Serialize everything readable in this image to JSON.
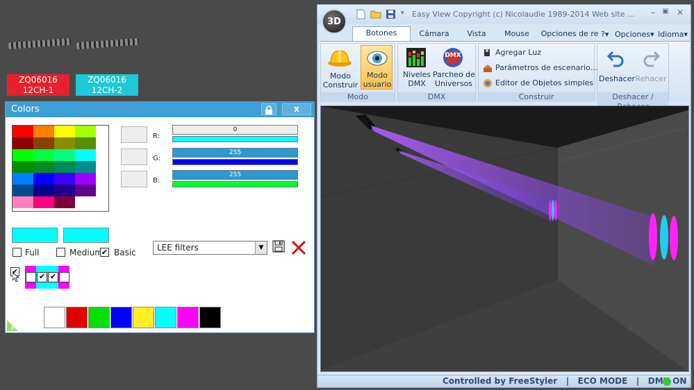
{
  "fixtures": [
    {
      "label_line1": "ZQ06016",
      "label_line2": "12CH-1",
      "color": "#e81f2c"
    },
    {
      "label_line1": "ZQ06016",
      "label_line2": "12CH-2",
      "color": "#1ec8d6"
    }
  ],
  "colors_panel": {
    "title": "Colors",
    "lock_icon": "lock-icon",
    "close_label": "x",
    "palette": [
      [
        "#ff0000",
        "#ff8000",
        "#ffff00",
        "#a6ff00"
      ],
      [
        "#8c0000",
        "#8c4000",
        "#8c8c00",
        "#5a8c00"
      ],
      [
        "#00ff00",
        "#00ff40",
        "#00ff80",
        "#00ffff"
      ],
      [
        "#008c00",
        "#008c20",
        "#008c50",
        "#008c8c"
      ],
      [
        "#0080ff",
        "#0000ff",
        "#4000ff",
        "#a000ff"
      ],
      [
        "#004c8c",
        "#00008c",
        "#20008c",
        "#60008c"
      ],
      [
        "#ff80c0",
        "#ff0080",
        "#80003c",
        "#ffffff"
      ]
    ],
    "preview_color_1": "#00ffff",
    "preview_color_2": "#00ffff",
    "channels": [
      {
        "label": "R:",
        "value": "0",
        "level": 0,
        "bar_color": "#00ffff"
      },
      {
        "label": "G:",
        "value": "255",
        "level": 1,
        "bar_color": "#0000ff"
      },
      {
        "label": "B:",
        "value": "255",
        "level": 1,
        "bar_color": "#00ff33"
      }
    ],
    "options": [
      {
        "label": "Full",
        "checked": false
      },
      {
        "label": "Medium",
        "checked": false
      },
      {
        "label": "Basic",
        "checked": true
      }
    ],
    "filter_select": "LEE filters",
    "mini_colors": [
      "#ff00ff",
      "#00ffff",
      "#00ffff",
      "#ff00ff"
    ],
    "mini_checks": [
      false,
      true,
      true,
      false
    ],
    "basic_colors": [
      "#ffffff",
      "#e00000",
      "#00e000",
      "#0000ff",
      "#ffee22",
      "#00ffff",
      "#ff00ff",
      "#000000"
    ]
  },
  "app": {
    "title": "Easy View   Copyright (c) Nicolaudie 1989-2014   Web site ...",
    "tabs": [
      "Botones estánd",
      "Cámara",
      "Vista",
      "Mouse",
      "Opciones de re"
    ],
    "right_menu": [
      "?",
      "Opciones",
      "Idioma"
    ],
    "groups": {
      "modo": {
        "label": "Modo",
        "construir": "Modo\nConstruir",
        "usuario": "Modo\nusuario"
      },
      "dmx": {
        "label": "DMX",
        "niveles": "Niveles\nDMX",
        "parcheo": "Parcheo de\nUniversos",
        "dmx_badge": "DMX"
      },
      "construir": {
        "label": "Construir",
        "items": [
          "Agregar Luz",
          "Parámetros de escenario...",
          "Editor de Objetos simples"
        ]
      },
      "deshacer": {
        "label": "Deshacer / Rehacer",
        "undo": "Deshacer",
        "redo": "Rehacer"
      }
    },
    "logo": "3D",
    "status": "Controlled by FreeStyler   |   ECO MODE   |   DMX ON",
    "status_led_color": "#33cc33"
  }
}
